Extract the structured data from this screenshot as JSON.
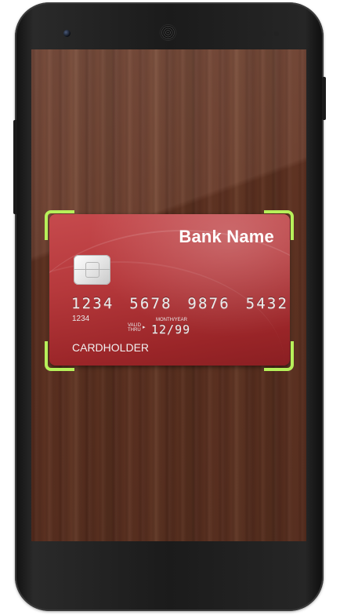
{
  "card": {
    "bank_name": "Bank Name",
    "number": "1234 5678 9876 5432",
    "number_prefix": "1234",
    "month_year_label": "MONTH/YEAR",
    "valid_label_line1": "VALID",
    "valid_label_line2": "THRU",
    "expiry": "12/99",
    "cardholder": "CARDHOLDER"
  },
  "colors": {
    "scan_frame": "#b6f05a",
    "card_red": "#b6393c",
    "wood": "#603322"
  },
  "icons": {
    "chip": "card-chip-icon",
    "arrow": "valid-thru-arrow-icon"
  }
}
